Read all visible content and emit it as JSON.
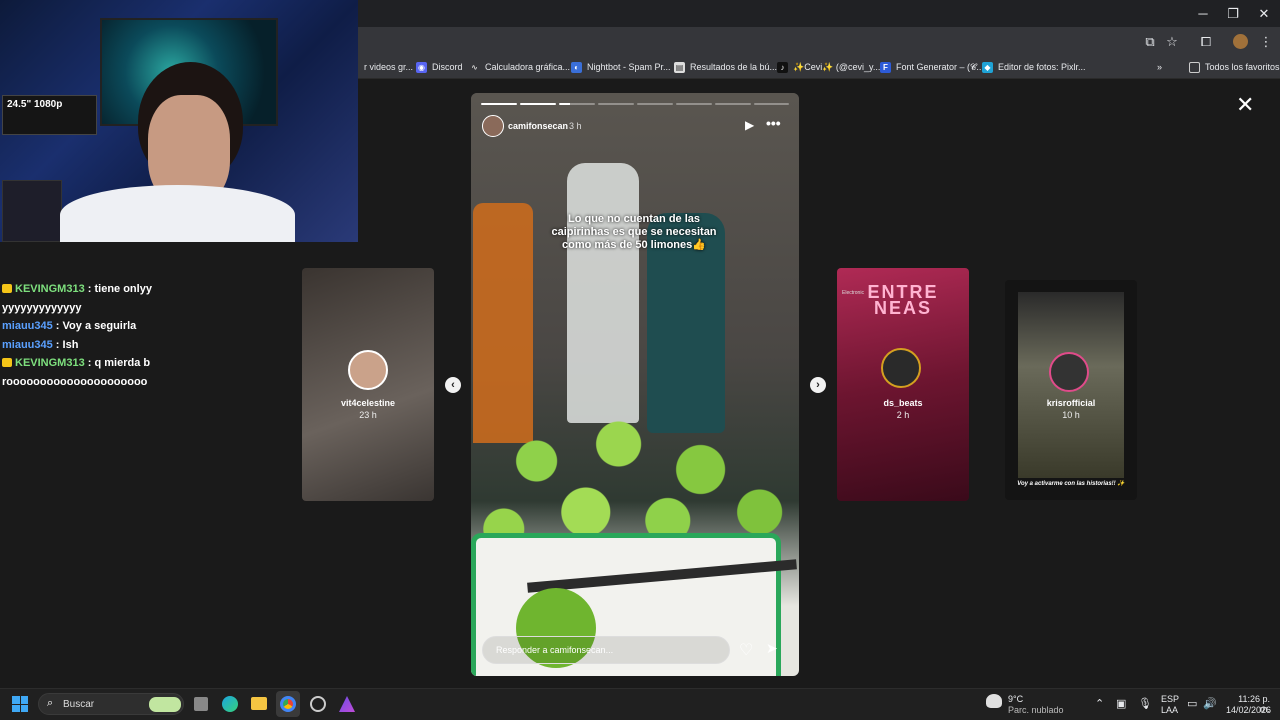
{
  "bookmarks": [
    {
      "label": "r videos gr...",
      "icon": "page-icon"
    },
    {
      "label": "Discord",
      "icon": "discord-icon"
    },
    {
      "label": "Calculadora gráfica...",
      "icon": "graph-icon"
    },
    {
      "label": "Nightbot - Spam Pr...",
      "icon": "nightbot-icon"
    },
    {
      "label": "Resultados de la bú...",
      "icon": "search-results-icon"
    },
    {
      "label": "✨Cevi✨ (@cevi_y...",
      "icon": "tiktok-icon"
    },
    {
      "label": "Font Generator – (𝓒...",
      "icon": "font-icon"
    },
    {
      "label": "Editor de fotos: Pixlr...",
      "icon": "pixlr-icon"
    }
  ],
  "bookmarks_all": "Todos los favoritos",
  "webcam_text": "24.5\" 1080p",
  "chat": [
    {
      "user": "KEVINGM313",
      "badge": true,
      "color": "green",
      "text": "tiene onlyyyyyyyyyyyyyyy"
    },
    {
      "user": "miauu345",
      "badge": false,
      "color": "blue",
      "text": "Voy a seguirla"
    },
    {
      "user": "miauu345",
      "badge": false,
      "color": "blue",
      "text": "Ish"
    },
    {
      "user": "KEVINGM313",
      "badge": true,
      "color": "green",
      "text": "q mierda brooooooooooooooooooooo"
    }
  ],
  "stories": {
    "left": {
      "name": "vit4celestine",
      "time": "23 h"
    },
    "main": {
      "user": "camifonsecan",
      "time": "3 h",
      "caption": "Lo que no cuentan de las caipirinhas es que se necesitan como más de 50 limones👍",
      "reply_placeholder": "Responder a camifonsecan...",
      "progress_total": 8,
      "progress_done": 2
    },
    "right1": {
      "name": "ds_beats",
      "time": "2 h",
      "banner": "ENTRE NEAS",
      "label": "Electronic"
    },
    "right2": {
      "name": "krisrofficial",
      "time": "10 h",
      "footer": "Voy a activarme con las historias!! ✨"
    }
  },
  "taskbar": {
    "search_label": "Buscar",
    "weather_temp": "9°C",
    "weather_desc": "Parc. nublado",
    "lang": "ESP",
    "lang_sub": "LAA",
    "time": "11:26 p. m.",
    "date": "14/02/2026"
  }
}
